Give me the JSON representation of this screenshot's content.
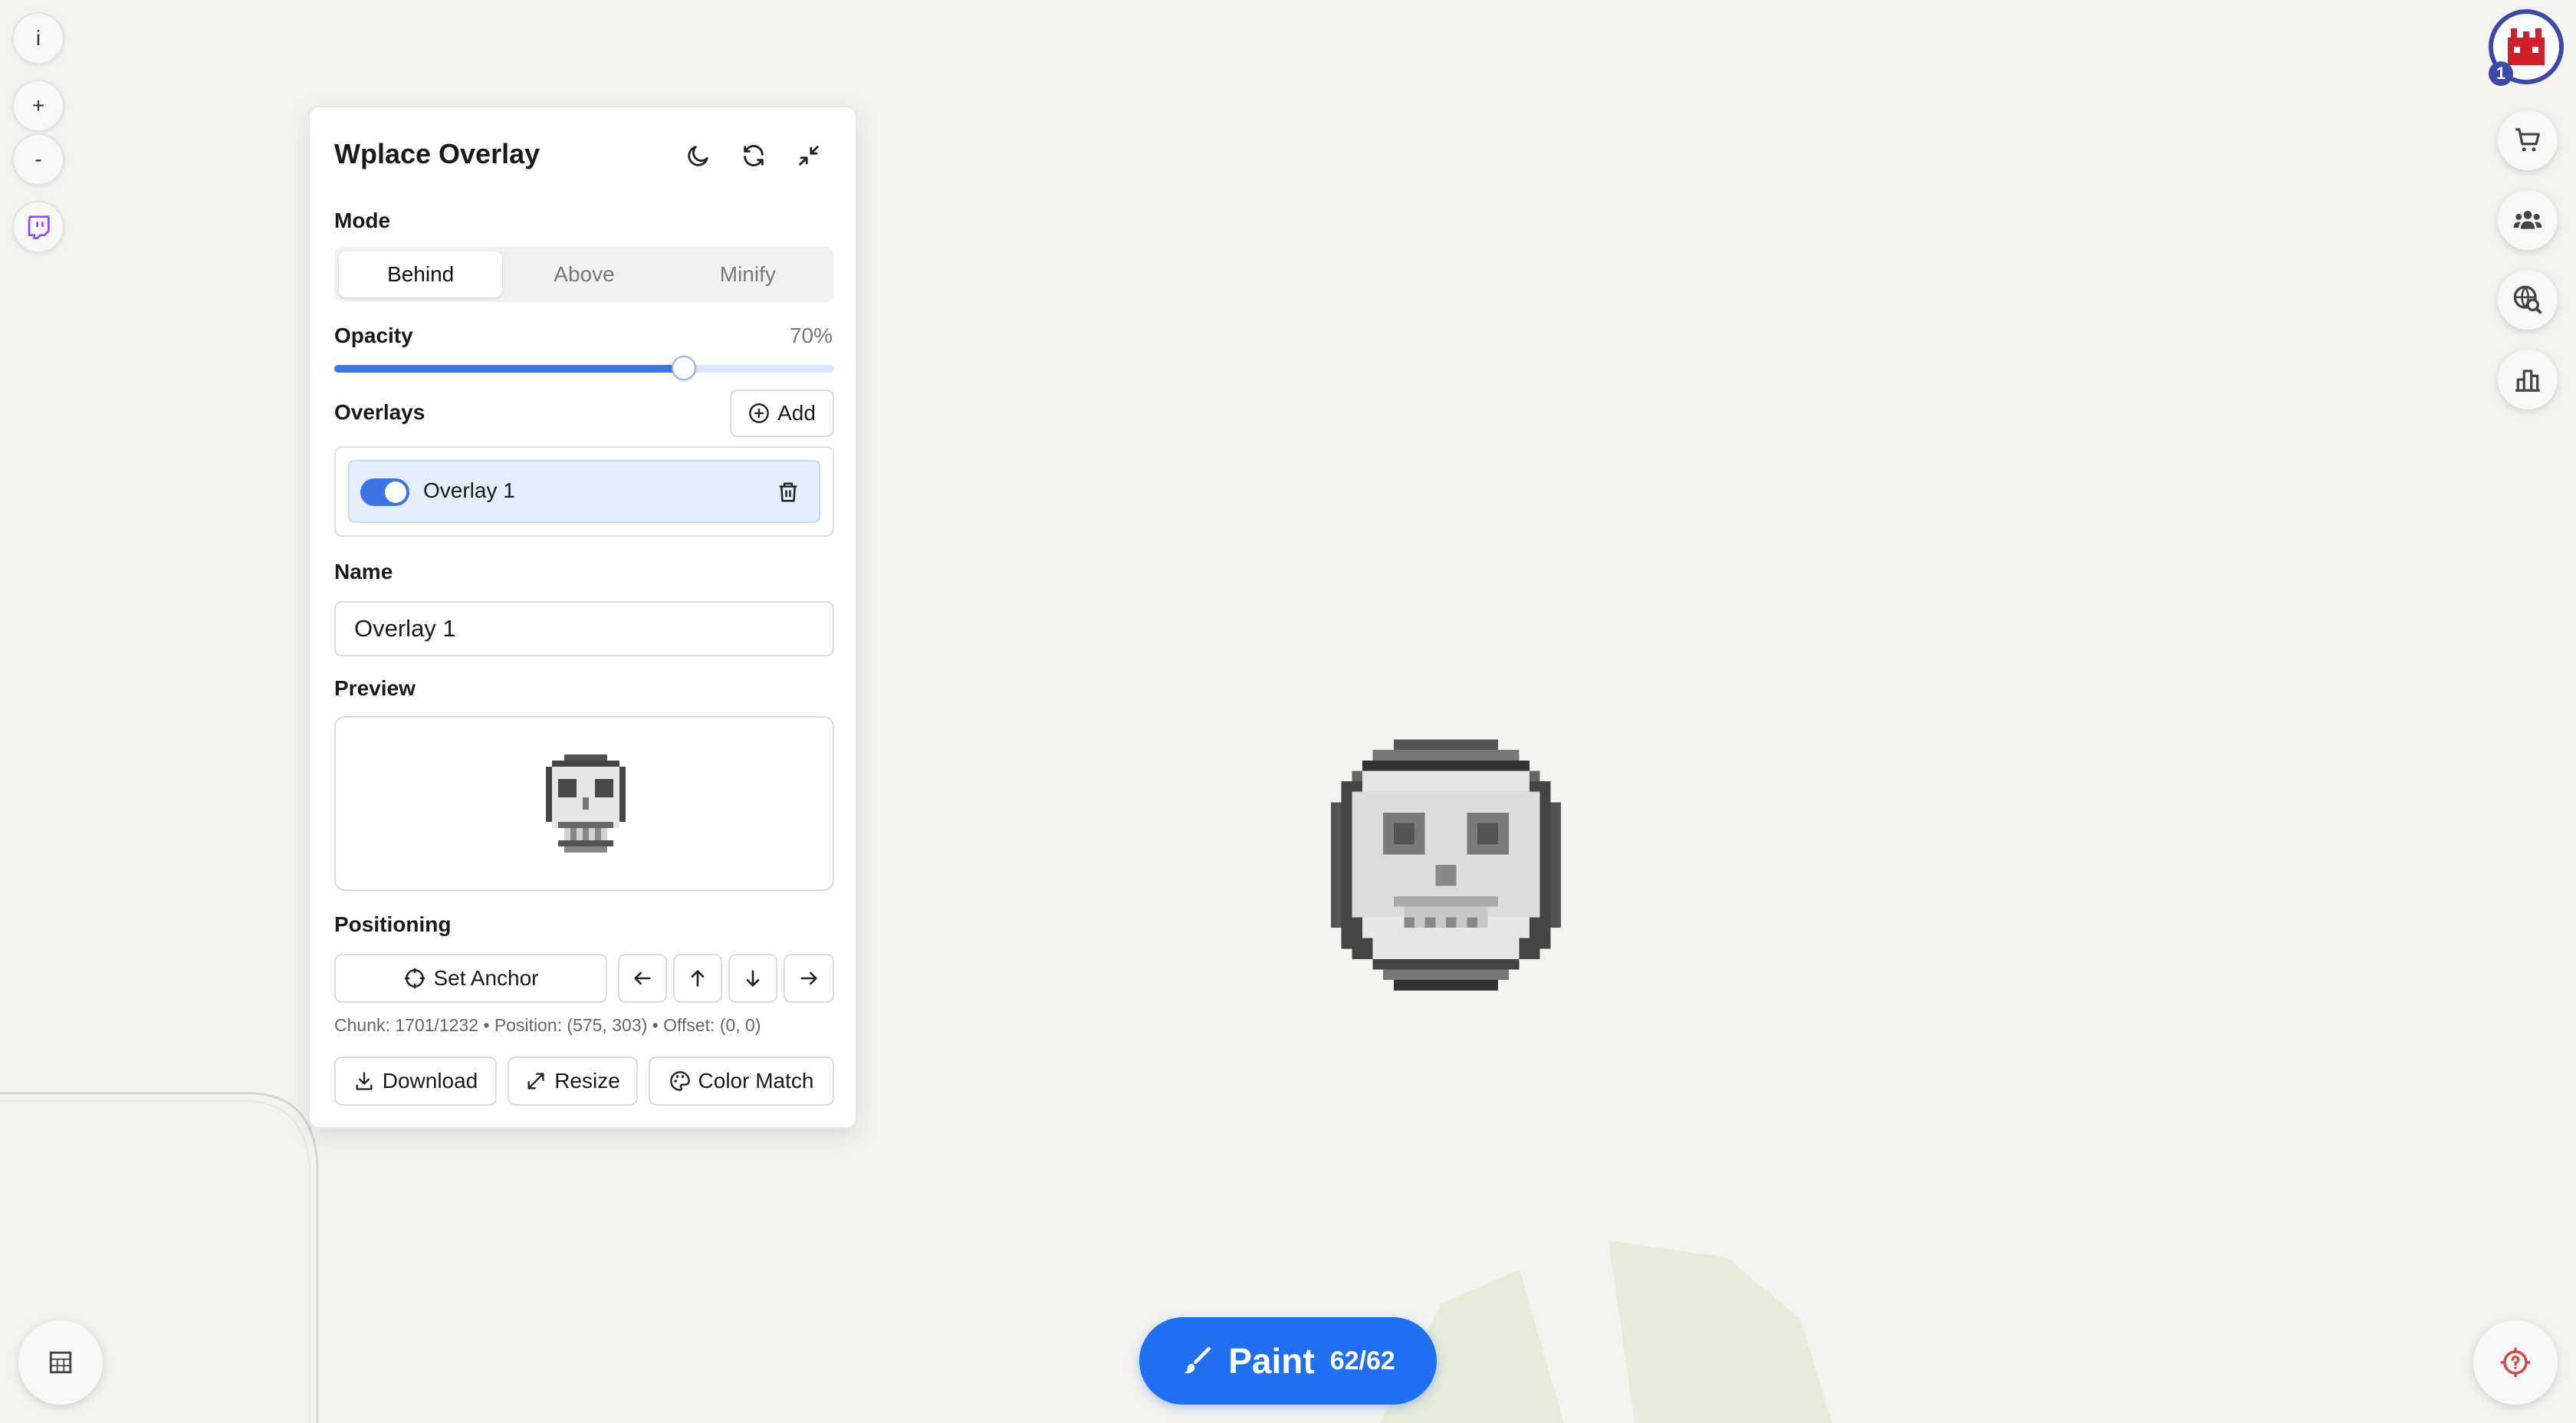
{
  "colors": {
    "accent": "#3a74e6",
    "paint": "#1f6ff0",
    "map_background": "#f5f3ef",
    "map_green": "#e6ecd9"
  },
  "left_controls": {
    "info": {
      "label": "i"
    },
    "zoom_in": {
      "label": "+"
    },
    "zoom_out": {
      "label": "-"
    },
    "twitch": {
      "icon": "twitch-icon"
    }
  },
  "right_controls": {
    "avatar_badge": "1",
    "icons": [
      "cart-icon",
      "group-icon",
      "search-globe-icon",
      "leaderboard-icon"
    ]
  },
  "panel": {
    "title": "Wplace Overlay",
    "header_icons": [
      "moon-icon",
      "refresh-icon",
      "collapse-icon"
    ],
    "mode": {
      "label": "Mode",
      "options": [
        "Behind",
        "Above",
        "Minify"
      ],
      "selected": "Behind"
    },
    "opacity": {
      "label": "Opacity",
      "value_text": "70%",
      "value": 0.7
    },
    "overlays": {
      "label": "Overlays",
      "add_label": "Add",
      "items": [
        {
          "name": "Overlay 1",
          "enabled": true
        }
      ]
    },
    "name": {
      "label": "Name",
      "value": "Overlay 1"
    },
    "preview": {
      "label": "Preview"
    },
    "positioning": {
      "label": "Positioning",
      "set_anchor_label": "Set Anchor",
      "coords_text": "Chunk: 1701/1232 • Position: (575, 303) • Offset: (0, 0)"
    },
    "actions": {
      "download_label": "Download",
      "resize_label": "Resize",
      "color_match_label": "Color Match"
    }
  },
  "paint_button": {
    "label": "Paint",
    "count": "62/62"
  }
}
